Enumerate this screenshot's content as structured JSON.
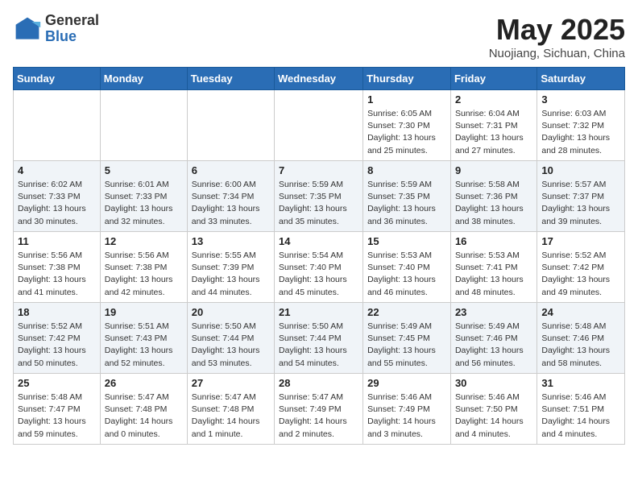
{
  "header": {
    "logo_general": "General",
    "logo_blue": "Blue",
    "month_title": "May 2025",
    "location": "Nuojiang, Sichuan, China"
  },
  "days_of_week": [
    "Sunday",
    "Monday",
    "Tuesday",
    "Wednesday",
    "Thursday",
    "Friday",
    "Saturday"
  ],
  "weeks": [
    [
      {
        "day": "",
        "content": ""
      },
      {
        "day": "",
        "content": ""
      },
      {
        "day": "",
        "content": ""
      },
      {
        "day": "",
        "content": ""
      },
      {
        "day": "1",
        "content": "Sunrise: 6:05 AM\nSunset: 7:30 PM\nDaylight: 13 hours\nand 25 minutes."
      },
      {
        "day": "2",
        "content": "Sunrise: 6:04 AM\nSunset: 7:31 PM\nDaylight: 13 hours\nand 27 minutes."
      },
      {
        "day": "3",
        "content": "Sunrise: 6:03 AM\nSunset: 7:32 PM\nDaylight: 13 hours\nand 28 minutes."
      }
    ],
    [
      {
        "day": "4",
        "content": "Sunrise: 6:02 AM\nSunset: 7:33 PM\nDaylight: 13 hours\nand 30 minutes."
      },
      {
        "day": "5",
        "content": "Sunrise: 6:01 AM\nSunset: 7:33 PM\nDaylight: 13 hours\nand 32 minutes."
      },
      {
        "day": "6",
        "content": "Sunrise: 6:00 AM\nSunset: 7:34 PM\nDaylight: 13 hours\nand 33 minutes."
      },
      {
        "day": "7",
        "content": "Sunrise: 5:59 AM\nSunset: 7:35 PM\nDaylight: 13 hours\nand 35 minutes."
      },
      {
        "day": "8",
        "content": "Sunrise: 5:59 AM\nSunset: 7:35 PM\nDaylight: 13 hours\nand 36 minutes."
      },
      {
        "day": "9",
        "content": "Sunrise: 5:58 AM\nSunset: 7:36 PM\nDaylight: 13 hours\nand 38 minutes."
      },
      {
        "day": "10",
        "content": "Sunrise: 5:57 AM\nSunset: 7:37 PM\nDaylight: 13 hours\nand 39 minutes."
      }
    ],
    [
      {
        "day": "11",
        "content": "Sunrise: 5:56 AM\nSunset: 7:38 PM\nDaylight: 13 hours\nand 41 minutes."
      },
      {
        "day": "12",
        "content": "Sunrise: 5:56 AM\nSunset: 7:38 PM\nDaylight: 13 hours\nand 42 minutes."
      },
      {
        "day": "13",
        "content": "Sunrise: 5:55 AM\nSunset: 7:39 PM\nDaylight: 13 hours\nand 44 minutes."
      },
      {
        "day": "14",
        "content": "Sunrise: 5:54 AM\nSunset: 7:40 PM\nDaylight: 13 hours\nand 45 minutes."
      },
      {
        "day": "15",
        "content": "Sunrise: 5:53 AM\nSunset: 7:40 PM\nDaylight: 13 hours\nand 46 minutes."
      },
      {
        "day": "16",
        "content": "Sunrise: 5:53 AM\nSunset: 7:41 PM\nDaylight: 13 hours\nand 48 minutes."
      },
      {
        "day": "17",
        "content": "Sunrise: 5:52 AM\nSunset: 7:42 PM\nDaylight: 13 hours\nand 49 minutes."
      }
    ],
    [
      {
        "day": "18",
        "content": "Sunrise: 5:52 AM\nSunset: 7:42 PM\nDaylight: 13 hours\nand 50 minutes."
      },
      {
        "day": "19",
        "content": "Sunrise: 5:51 AM\nSunset: 7:43 PM\nDaylight: 13 hours\nand 52 minutes."
      },
      {
        "day": "20",
        "content": "Sunrise: 5:50 AM\nSunset: 7:44 PM\nDaylight: 13 hours\nand 53 minutes."
      },
      {
        "day": "21",
        "content": "Sunrise: 5:50 AM\nSunset: 7:44 PM\nDaylight: 13 hours\nand 54 minutes."
      },
      {
        "day": "22",
        "content": "Sunrise: 5:49 AM\nSunset: 7:45 PM\nDaylight: 13 hours\nand 55 minutes."
      },
      {
        "day": "23",
        "content": "Sunrise: 5:49 AM\nSunset: 7:46 PM\nDaylight: 13 hours\nand 56 minutes."
      },
      {
        "day": "24",
        "content": "Sunrise: 5:48 AM\nSunset: 7:46 PM\nDaylight: 13 hours\nand 58 minutes."
      }
    ],
    [
      {
        "day": "25",
        "content": "Sunrise: 5:48 AM\nSunset: 7:47 PM\nDaylight: 13 hours\nand 59 minutes."
      },
      {
        "day": "26",
        "content": "Sunrise: 5:47 AM\nSunset: 7:48 PM\nDaylight: 14 hours\nand 0 minutes."
      },
      {
        "day": "27",
        "content": "Sunrise: 5:47 AM\nSunset: 7:48 PM\nDaylight: 14 hours\nand 1 minute."
      },
      {
        "day": "28",
        "content": "Sunrise: 5:47 AM\nSunset: 7:49 PM\nDaylight: 14 hours\nand 2 minutes."
      },
      {
        "day": "29",
        "content": "Sunrise: 5:46 AM\nSunset: 7:49 PM\nDaylight: 14 hours\nand 3 minutes."
      },
      {
        "day": "30",
        "content": "Sunrise: 5:46 AM\nSunset: 7:50 PM\nDaylight: 14 hours\nand 4 minutes."
      },
      {
        "day": "31",
        "content": "Sunrise: 5:46 AM\nSunset: 7:51 PM\nDaylight: 14 hours\nand 4 minutes."
      }
    ]
  ]
}
